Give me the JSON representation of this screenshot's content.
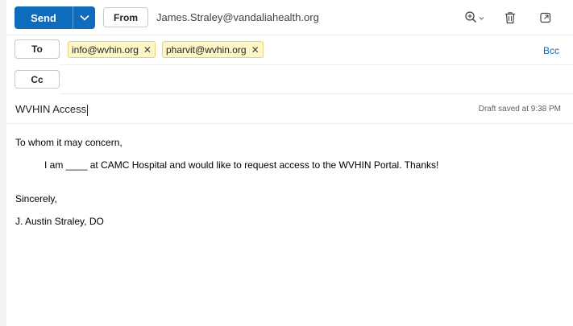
{
  "header": {
    "send_label": "Send",
    "from_label": "From",
    "from_address": "James.Straley@vandaliahealth.org"
  },
  "recipients": {
    "to_label": "To",
    "cc_label": "Cc",
    "bcc_label": "Bcc",
    "to": [
      "info@wvhin.org",
      "pharvit@wvhin.org"
    ]
  },
  "subject": {
    "value": "WVHIN Access",
    "draft_status": "Draft saved at 9:38 PM"
  },
  "body": {
    "greeting": "To whom it may concern,",
    "paragraph": "I am ____ at CAMC Hospital and would like to request access to the WVHIN Portal. Thanks!",
    "closing": "Sincerely,",
    "signature": "J. Austin Straley, DO"
  },
  "icons": [
    "chevron-down-icon",
    "zoom-icon",
    "delete-icon",
    "popout-icon",
    "close-icon"
  ],
  "colors": {
    "accent": "#0f6cbd",
    "chip_bg": "#fdf6c7",
    "chip_border": "#e6d27a"
  }
}
